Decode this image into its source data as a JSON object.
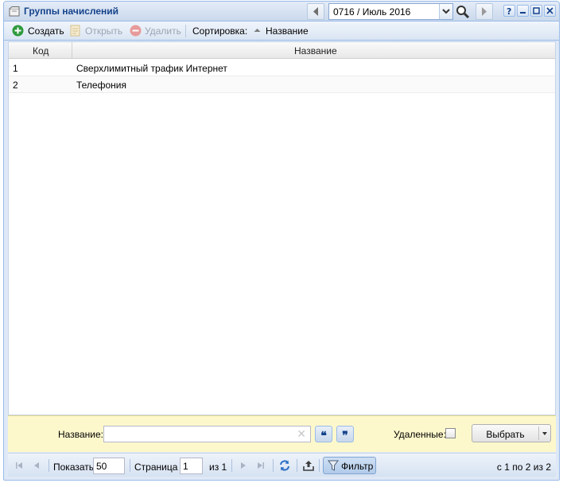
{
  "window": {
    "title": "Группы начислений",
    "period": "0716 / Июль 2016"
  },
  "toolbar": {
    "create_label": "Создать",
    "open_label": "Открыть",
    "delete_label": "Удалить",
    "sort_label": "Сортировка:",
    "sort_field": "Название"
  },
  "grid": {
    "columns": [
      "Код",
      "Название"
    ],
    "rows": [
      {
        "code": "1",
        "name": "Сверхлимитный трафик Интернет"
      },
      {
        "code": "2",
        "name": "Телефония"
      }
    ]
  },
  "filter": {
    "name_label": "Название:",
    "name_value": "",
    "quote_open": "❝",
    "quote_close": "❞",
    "deleted_label": "Удаленные:",
    "deleted_checked": false,
    "select_label": "Выбрать"
  },
  "pager": {
    "show_label": "Показать",
    "page_size": "50",
    "page_label": "Страница",
    "page_value": "1",
    "of_label": "из 1",
    "filter_label": "Фильтр",
    "info": "с 1 по 2 из 2"
  },
  "icons": {
    "create": "plus-circle-icon",
    "open": "document-icon",
    "delete": "minus-circle-icon",
    "sort": "sort-asc-icon"
  }
}
